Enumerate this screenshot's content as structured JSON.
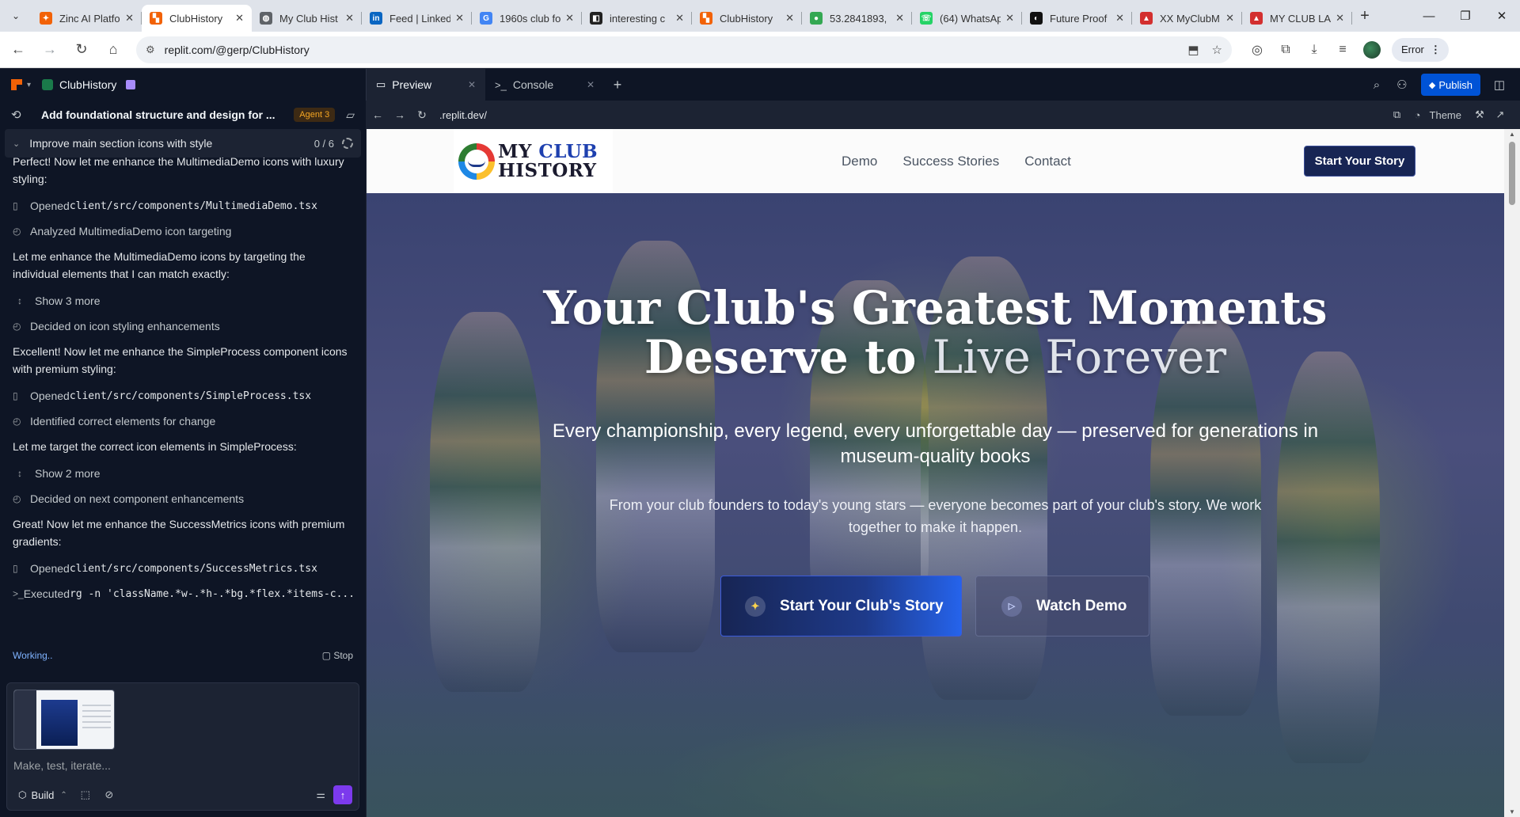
{
  "browser": {
    "tabs": [
      {
        "title": "Zinc AI Platfo",
        "fav_color": "#f26207",
        "fav_glyph": "✦",
        "active": false
      },
      {
        "title": "ClubHistory",
        "fav_color": "#f26207",
        "fav_glyph": "▚",
        "active": true
      },
      {
        "title": "My Club Hist",
        "fav_color": "#5f6368",
        "fav_glyph": "◍",
        "active": false
      },
      {
        "title": "Feed | Linked",
        "fav_color": "#0a66c2",
        "fav_glyph": "in",
        "active": false
      },
      {
        "title": "1960s club fo",
        "fav_color": "#4285f4",
        "fav_glyph": "G",
        "active": false
      },
      {
        "title": "interesting c",
        "fav_color": "#222222",
        "fav_glyph": "◧",
        "active": false
      },
      {
        "title": "ClubHistory",
        "fav_color": "#f26207",
        "fav_glyph": "▚",
        "active": false
      },
      {
        "title": "53.2841893,",
        "fav_color": "#34a853",
        "fav_glyph": "●",
        "active": false
      },
      {
        "title": "(64) WhatsAp",
        "fav_color": "#25d366",
        "fav_glyph": "☏",
        "active": false
      },
      {
        "title": "Future Proof",
        "fav_color": "#111111",
        "fav_glyph": "◐",
        "active": false
      },
      {
        "title": "XX MyClubM",
        "fav_color": "#d32f2f",
        "fav_glyph": "▲",
        "active": false
      },
      {
        "title": "MY CLUB LA",
        "fav_color": "#d32f2f",
        "fav_glyph": "▲",
        "active": false
      }
    ],
    "close_glyph": "✕",
    "url": "replit.com/@gerp/ClubHistory",
    "error_label": "Error"
  },
  "replit": {
    "project_name": "ClubHistory",
    "tabs": [
      {
        "label": "Preview",
        "icon": "▭"
      },
      {
        "label": "Console",
        "icon": ">_"
      }
    ],
    "publish_label": "Publish"
  },
  "agent": {
    "thread_title": "Add foundational structure and design for ...",
    "agent_badge": "Agent 3",
    "task_label": "Improve main section icons with style",
    "task_count": "0 / 6",
    "feed": [
      {
        "kind": "msg",
        "text": "Perfect! Now let me enhance the MultimediaDemo icons with luxury styling:"
      },
      {
        "kind": "act",
        "icon": "book-icon",
        "prefix": "Opened ",
        "code": "client/src/components/MultimediaDemo.tsx"
      },
      {
        "kind": "act",
        "icon": "analysis-icon",
        "prefix": "Analyzed MultimediaDemo icon targeting",
        "code": ""
      },
      {
        "kind": "msg",
        "text": "Let me enhance the MultimediaDemo icons by targeting the individual elements that I can match exactly:"
      },
      {
        "kind": "more",
        "icon": "expand-icon",
        "prefix": "Show 3 more",
        "code": ""
      },
      {
        "kind": "act",
        "icon": "analysis-icon",
        "prefix": "Decided on icon styling enhancements",
        "code": ""
      },
      {
        "kind": "msg",
        "text": "Excellent! Now let me enhance the SimpleProcess component icons with premium styling:"
      },
      {
        "kind": "act",
        "icon": "book-icon",
        "prefix": "Opened ",
        "code": "client/src/components/SimpleProcess.tsx"
      },
      {
        "kind": "act",
        "icon": "analysis-icon",
        "prefix": "Identified correct elements for change",
        "code": ""
      },
      {
        "kind": "msg",
        "text": "Let me target the correct icon elements in SimpleProcess:"
      },
      {
        "kind": "more",
        "icon": "expand-icon",
        "prefix": "Show 2 more",
        "code": ""
      },
      {
        "kind": "act",
        "icon": "analysis-icon",
        "prefix": "Decided on next component enhancements",
        "code": ""
      },
      {
        "kind": "msg",
        "text": "Great! Now let me enhance the SuccessMetrics icons with premium gradients:"
      },
      {
        "kind": "act",
        "icon": "book-icon",
        "prefix": "Opened ",
        "code": "client/src/components/SuccessMetrics.tsx"
      },
      {
        "kind": "act",
        "icon": "terminal-icon",
        "prefix": "Executed ",
        "code": "rg -n 'className.*w-.*h-.*bg.*flex.*items-c..."
      }
    ],
    "status": "Working..",
    "stop_label": "Stop",
    "composer_placeholder": "Make, test, iterate...",
    "build_label": "Build"
  },
  "preview": {
    "url": ".replit.dev/",
    "theme_label": "Theme"
  },
  "site": {
    "logo_line1_a": "MY ",
    "logo_line1_b": "CLUB",
    "logo_line2": "HISTORY",
    "nav_links": [
      "Demo",
      "Success Stories",
      "Contact"
    ],
    "nav_cta": "Start Your Story",
    "hero": {
      "title_line1": "Your Club's Greatest Moments",
      "title_line2_a": "Deserve to ",
      "title_line2_b": "Live Forever",
      "subtitle": "Every championship, every legend, every unforgettable day — preserved for generations in museum-quality books",
      "body": "From your club founders to today's young stars — everyone becomes part of your club's story. We work together to make it happen.",
      "primary_cta": "Start Your Club's Story",
      "secondary_cta": "Watch Demo"
    }
  }
}
